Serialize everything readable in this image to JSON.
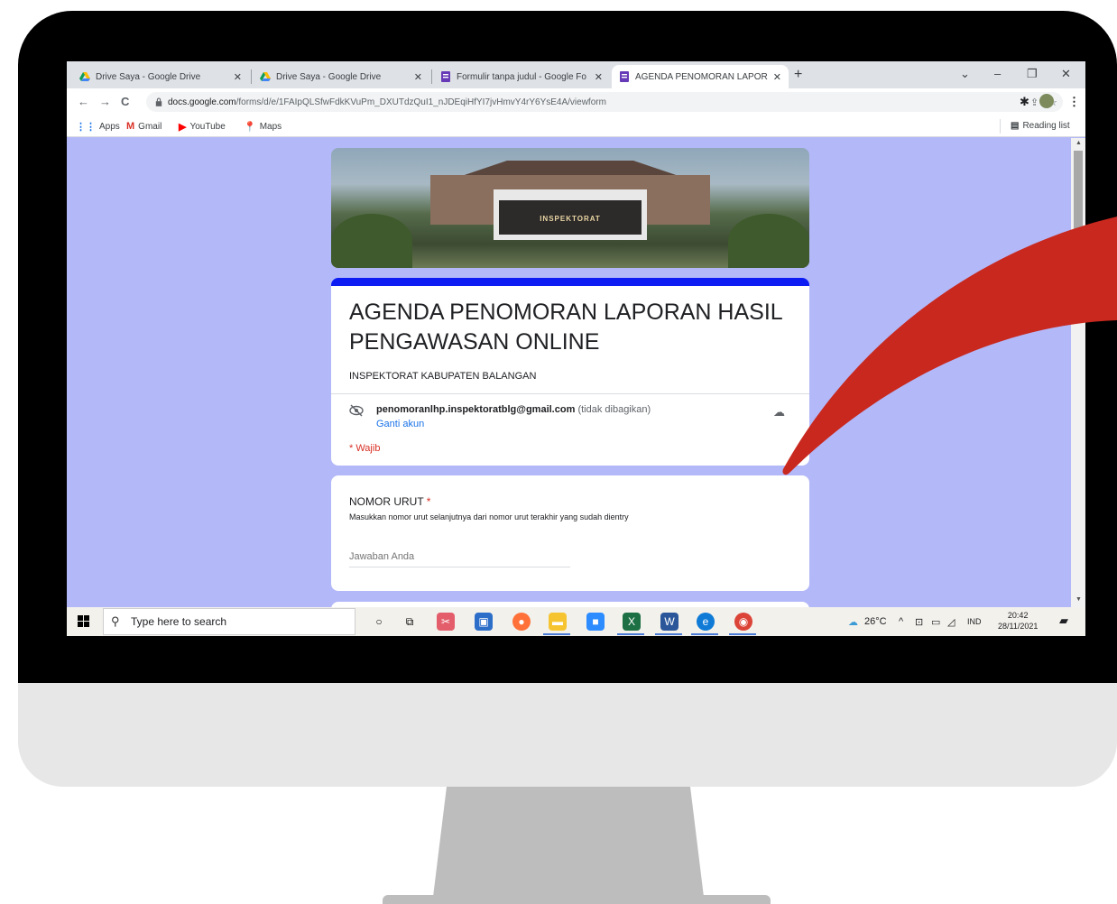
{
  "browser": {
    "tabs": [
      {
        "title": "Drive Saya - Google Drive",
        "icon": "google-drive-icon",
        "active": false
      },
      {
        "title": "Drive Saya - Google Drive",
        "icon": "google-drive-icon",
        "active": false
      },
      {
        "title": "Formulir tanpa judul - Google Fo",
        "icon": "google-forms-icon",
        "active": false
      },
      {
        "title": "AGENDA PENOMORAN LAPORA",
        "icon": "google-forms-icon",
        "active": true
      }
    ],
    "close_glyph": "✕",
    "new_tab_glyph": "+",
    "address": {
      "host": "docs.google.com",
      "path": "/forms/d/e/1FAIpQLSfwFdkKVuPm_DXUTdzQuI1_nJDEqiHfYI7jvHmvY4rY6YsE4A/viewform"
    },
    "bookmarks": [
      {
        "label": "Apps",
        "icon": "apps-grid-icon",
        "glyph": "⋮⋮",
        "color": "#1a73e8"
      },
      {
        "label": "Gmail",
        "icon": "gmail-icon",
        "glyph": "M",
        "color": "#d93025"
      },
      {
        "label": "YouTube",
        "icon": "youtube-icon",
        "glyph": "▶",
        "color": "#ff0000"
      },
      {
        "label": "Maps",
        "icon": "maps-pin-icon",
        "glyph": "⬤",
        "color": "#34a853"
      }
    ],
    "reading_list": "Reading list"
  },
  "header_image": {
    "sign_text": "INSPEKTORAT"
  },
  "form": {
    "title": "AGENDA PENOMORAN LAPORAN HASIL PENGAWASAN ONLINE",
    "description": "INSPEKTORAT KABUPATEN BALANGAN",
    "account_email": "penomoranlhp.inspektoratblg@gmail.com",
    "account_note": "(tidak dibagikan)",
    "switch_account": "Ganti akun",
    "required_note": "* Wajib",
    "question": {
      "title": "NOMOR URUT",
      "required_mark": "*",
      "help": "Masukkan nomor urut selanjutnya dari nomor urut terakhir yang sudah dientry",
      "placeholder": "Jawaban Anda"
    }
  },
  "taskbar": {
    "search_placeholder": "Type here to search",
    "weather": "26°C",
    "language": "IND",
    "time": "20:42",
    "date": "28/11/2021"
  },
  "colors": {
    "form_background": "#b3b8f8",
    "form_accent": "#0c1cf3",
    "required": "#d93025",
    "arrow": "#c8281e"
  }
}
